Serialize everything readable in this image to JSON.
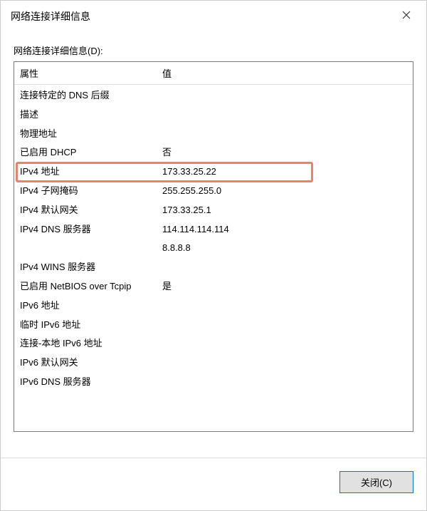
{
  "window": {
    "title": "网络连接详细信息"
  },
  "field_label": "网络连接详细信息(D):",
  "columns": {
    "property": "属性",
    "value": "值"
  },
  "rows": [
    {
      "prop": "连接特定的 DNS 后缀",
      "val": ""
    },
    {
      "prop": "描述",
      "val": ""
    },
    {
      "prop": "物理地址",
      "val": ""
    },
    {
      "prop": "已启用 DHCP",
      "val": "否"
    },
    {
      "prop": "IPv4 地址",
      "val": "173.33.25.22",
      "highlight": true
    },
    {
      "prop": "IPv4 子网掩码",
      "val": "255.255.255.0"
    },
    {
      "prop": "IPv4 默认网关",
      "val": "173.33.25.1"
    },
    {
      "prop": "IPv4 DNS 服务器",
      "val": "114.114.114.114"
    },
    {
      "prop": "",
      "val": "8.8.8.8"
    },
    {
      "prop": "IPv4 WINS 服务器",
      "val": ""
    },
    {
      "prop": "已启用 NetBIOS over Tcpip",
      "val": "是"
    },
    {
      "prop": "IPv6 地址",
      "val": ""
    },
    {
      "prop": "临时 IPv6 地址",
      "val": ""
    },
    {
      "prop": "连接-本地 IPv6 地址",
      "val": ""
    },
    {
      "prop": "IPv6 默认网关",
      "val": ""
    },
    {
      "prop": "IPv6 DNS 服务器",
      "val": ""
    }
  ],
  "buttons": {
    "close": "关闭(C)"
  }
}
